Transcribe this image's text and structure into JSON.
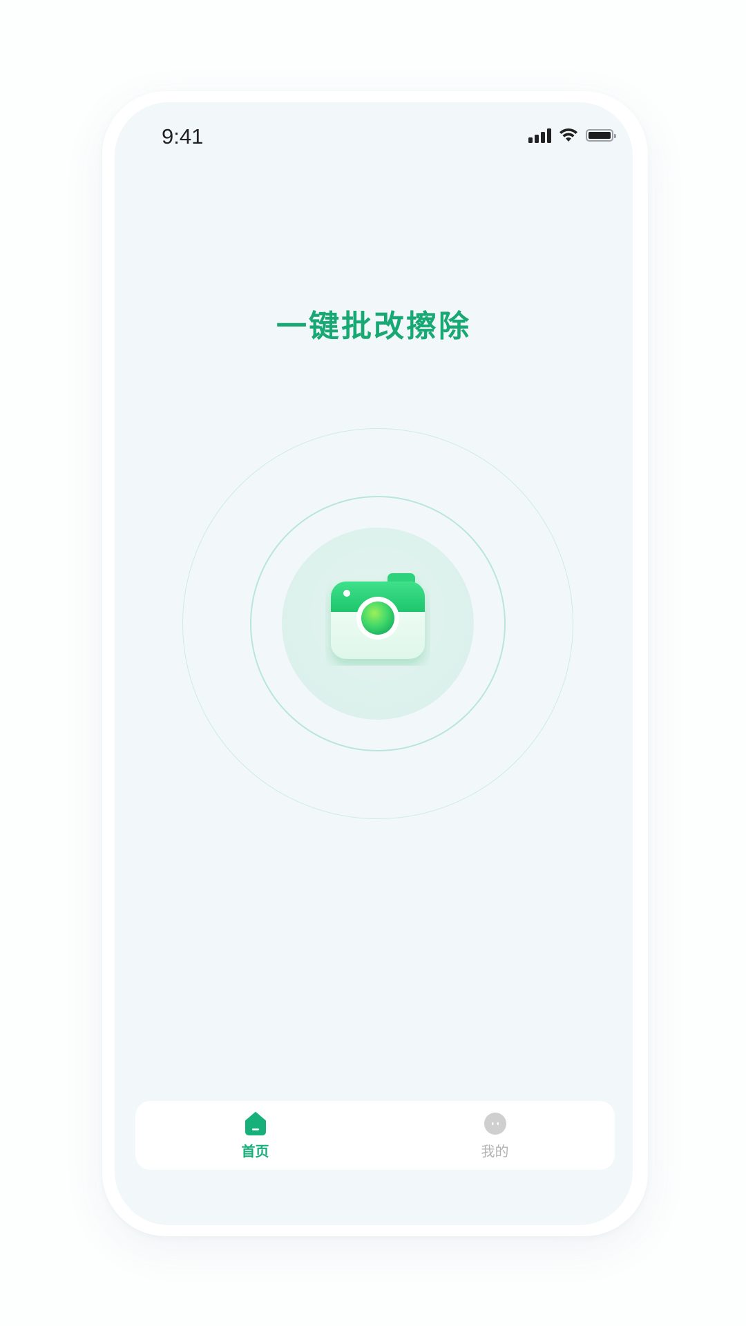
{
  "status_bar": {
    "time": "9:41",
    "icons": [
      "cellular-signal-icon",
      "wifi-icon",
      "battery-icon"
    ]
  },
  "main": {
    "title": "一键批改擦除",
    "action_icon": "camera-icon"
  },
  "tab_bar": {
    "items": [
      {
        "label": "首页",
        "icon": "home-icon",
        "active": true
      },
      {
        "label": "我的",
        "icon": "profile-icon",
        "active": false
      }
    ]
  },
  "colors": {
    "accent": "#17a874",
    "screen_background": "#f2f7fa",
    "inactive_tab": "#b3b3b3"
  }
}
